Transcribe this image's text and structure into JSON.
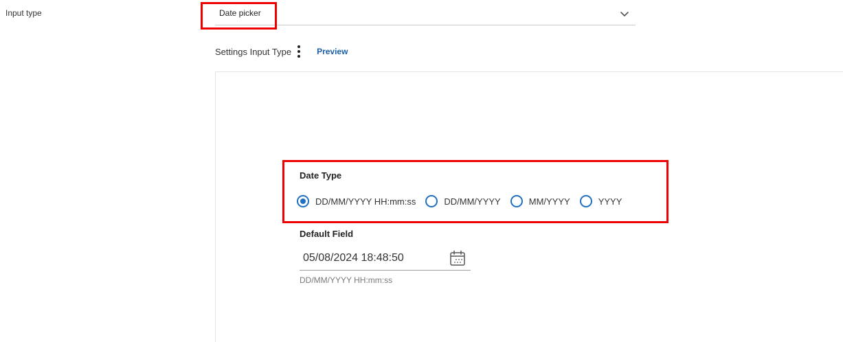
{
  "form": {
    "input_type_label": "Input type",
    "input_type_value": "Date picker",
    "settings_title": "Settings Input Type",
    "preview_link": "Preview"
  },
  "preview": {
    "date_type_label": "Date Type",
    "date_type_options": [
      {
        "label": "DD/MM/YYYY HH:mm:ss",
        "selected": true
      },
      {
        "label": "DD/MM/YYYY",
        "selected": false
      },
      {
        "label": "MM/YYYY",
        "selected": false
      },
      {
        "label": "YYYY",
        "selected": false
      }
    ],
    "default_field_label": "Default Field",
    "default_field_value": "05/08/2024 18:48:50",
    "default_field_hint": "DD/MM/YYYY HH:mm:ss"
  },
  "icons": {
    "select_chevron": "chevron-down-icon",
    "menu": "more-vert-icon",
    "calendar": "calendar-icon"
  },
  "colors": {
    "accent": "#1f6fc2",
    "link": "#1a5fa8",
    "highlight": "#ee0000"
  }
}
